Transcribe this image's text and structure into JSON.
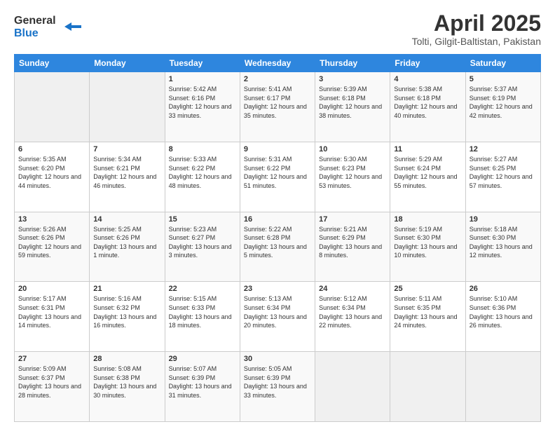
{
  "logo": {
    "line1": "General",
    "line2": "Blue"
  },
  "title": "April 2025",
  "subtitle": "Tolti, Gilgit-Baltistan, Pakistan",
  "weekdays": [
    "Sunday",
    "Monday",
    "Tuesday",
    "Wednesday",
    "Thursday",
    "Friday",
    "Saturday"
  ],
  "weeks": [
    [
      {
        "day": "",
        "sunrise": "",
        "sunset": "",
        "daylight": ""
      },
      {
        "day": "",
        "sunrise": "",
        "sunset": "",
        "daylight": ""
      },
      {
        "day": "1",
        "sunrise": "Sunrise: 5:42 AM",
        "sunset": "Sunset: 6:16 PM",
        "daylight": "Daylight: 12 hours and 33 minutes."
      },
      {
        "day": "2",
        "sunrise": "Sunrise: 5:41 AM",
        "sunset": "Sunset: 6:17 PM",
        "daylight": "Daylight: 12 hours and 35 minutes."
      },
      {
        "day": "3",
        "sunrise": "Sunrise: 5:39 AM",
        "sunset": "Sunset: 6:18 PM",
        "daylight": "Daylight: 12 hours and 38 minutes."
      },
      {
        "day": "4",
        "sunrise": "Sunrise: 5:38 AM",
        "sunset": "Sunset: 6:18 PM",
        "daylight": "Daylight: 12 hours and 40 minutes."
      },
      {
        "day": "5",
        "sunrise": "Sunrise: 5:37 AM",
        "sunset": "Sunset: 6:19 PM",
        "daylight": "Daylight: 12 hours and 42 minutes."
      }
    ],
    [
      {
        "day": "6",
        "sunrise": "Sunrise: 5:35 AM",
        "sunset": "Sunset: 6:20 PM",
        "daylight": "Daylight: 12 hours and 44 minutes."
      },
      {
        "day": "7",
        "sunrise": "Sunrise: 5:34 AM",
        "sunset": "Sunset: 6:21 PM",
        "daylight": "Daylight: 12 hours and 46 minutes."
      },
      {
        "day": "8",
        "sunrise": "Sunrise: 5:33 AM",
        "sunset": "Sunset: 6:22 PM",
        "daylight": "Daylight: 12 hours and 48 minutes."
      },
      {
        "day": "9",
        "sunrise": "Sunrise: 5:31 AM",
        "sunset": "Sunset: 6:22 PM",
        "daylight": "Daylight: 12 hours and 51 minutes."
      },
      {
        "day": "10",
        "sunrise": "Sunrise: 5:30 AM",
        "sunset": "Sunset: 6:23 PM",
        "daylight": "Daylight: 12 hours and 53 minutes."
      },
      {
        "day": "11",
        "sunrise": "Sunrise: 5:29 AM",
        "sunset": "Sunset: 6:24 PM",
        "daylight": "Daylight: 12 hours and 55 minutes."
      },
      {
        "day": "12",
        "sunrise": "Sunrise: 5:27 AM",
        "sunset": "Sunset: 6:25 PM",
        "daylight": "Daylight: 12 hours and 57 minutes."
      }
    ],
    [
      {
        "day": "13",
        "sunrise": "Sunrise: 5:26 AM",
        "sunset": "Sunset: 6:26 PM",
        "daylight": "Daylight: 12 hours and 59 minutes."
      },
      {
        "day": "14",
        "sunrise": "Sunrise: 5:25 AM",
        "sunset": "Sunset: 6:26 PM",
        "daylight": "Daylight: 13 hours and 1 minute."
      },
      {
        "day": "15",
        "sunrise": "Sunrise: 5:23 AM",
        "sunset": "Sunset: 6:27 PM",
        "daylight": "Daylight: 13 hours and 3 minutes."
      },
      {
        "day": "16",
        "sunrise": "Sunrise: 5:22 AM",
        "sunset": "Sunset: 6:28 PM",
        "daylight": "Daylight: 13 hours and 5 minutes."
      },
      {
        "day": "17",
        "sunrise": "Sunrise: 5:21 AM",
        "sunset": "Sunset: 6:29 PM",
        "daylight": "Daylight: 13 hours and 8 minutes."
      },
      {
        "day": "18",
        "sunrise": "Sunrise: 5:19 AM",
        "sunset": "Sunset: 6:30 PM",
        "daylight": "Daylight: 13 hours and 10 minutes."
      },
      {
        "day": "19",
        "sunrise": "Sunrise: 5:18 AM",
        "sunset": "Sunset: 6:30 PM",
        "daylight": "Daylight: 13 hours and 12 minutes."
      }
    ],
    [
      {
        "day": "20",
        "sunrise": "Sunrise: 5:17 AM",
        "sunset": "Sunset: 6:31 PM",
        "daylight": "Daylight: 13 hours and 14 minutes."
      },
      {
        "day": "21",
        "sunrise": "Sunrise: 5:16 AM",
        "sunset": "Sunset: 6:32 PM",
        "daylight": "Daylight: 13 hours and 16 minutes."
      },
      {
        "day": "22",
        "sunrise": "Sunrise: 5:15 AM",
        "sunset": "Sunset: 6:33 PM",
        "daylight": "Daylight: 13 hours and 18 minutes."
      },
      {
        "day": "23",
        "sunrise": "Sunrise: 5:13 AM",
        "sunset": "Sunset: 6:34 PM",
        "daylight": "Daylight: 13 hours and 20 minutes."
      },
      {
        "day": "24",
        "sunrise": "Sunrise: 5:12 AM",
        "sunset": "Sunset: 6:34 PM",
        "daylight": "Daylight: 13 hours and 22 minutes."
      },
      {
        "day": "25",
        "sunrise": "Sunrise: 5:11 AM",
        "sunset": "Sunset: 6:35 PM",
        "daylight": "Daylight: 13 hours and 24 minutes."
      },
      {
        "day": "26",
        "sunrise": "Sunrise: 5:10 AM",
        "sunset": "Sunset: 6:36 PM",
        "daylight": "Daylight: 13 hours and 26 minutes."
      }
    ],
    [
      {
        "day": "27",
        "sunrise": "Sunrise: 5:09 AM",
        "sunset": "Sunset: 6:37 PM",
        "daylight": "Daylight: 13 hours and 28 minutes."
      },
      {
        "day": "28",
        "sunrise": "Sunrise: 5:08 AM",
        "sunset": "Sunset: 6:38 PM",
        "daylight": "Daylight: 13 hours and 30 minutes."
      },
      {
        "day": "29",
        "sunrise": "Sunrise: 5:07 AM",
        "sunset": "Sunset: 6:39 PM",
        "daylight": "Daylight: 13 hours and 31 minutes."
      },
      {
        "day": "30",
        "sunrise": "Sunrise: 5:05 AM",
        "sunset": "Sunset: 6:39 PM",
        "daylight": "Daylight: 13 hours and 33 minutes."
      },
      {
        "day": "",
        "sunrise": "",
        "sunset": "",
        "daylight": ""
      },
      {
        "day": "",
        "sunrise": "",
        "sunset": "",
        "daylight": ""
      },
      {
        "day": "",
        "sunrise": "",
        "sunset": "",
        "daylight": ""
      }
    ]
  ]
}
